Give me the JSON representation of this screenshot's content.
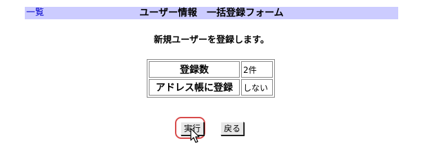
{
  "header": {
    "link_label": "一覧",
    "title": "ユーザー情報　一括登録フォーム"
  },
  "main": {
    "subheading": "新規ユーザーを登録します。",
    "summary": {
      "rows": [
        {
          "label": "登録数",
          "value": "2件"
        },
        {
          "label": "アドレス帳に登録",
          "value": "しない"
        }
      ]
    },
    "buttons": {
      "execute_label": "実行",
      "back_label": "戻る"
    }
  },
  "colors": {
    "header_bg": "#ccccff",
    "link": "#0000cc",
    "highlight": "#d84a4a"
  },
  "icons": {
    "cursor": "mouse-pointer-icon"
  }
}
